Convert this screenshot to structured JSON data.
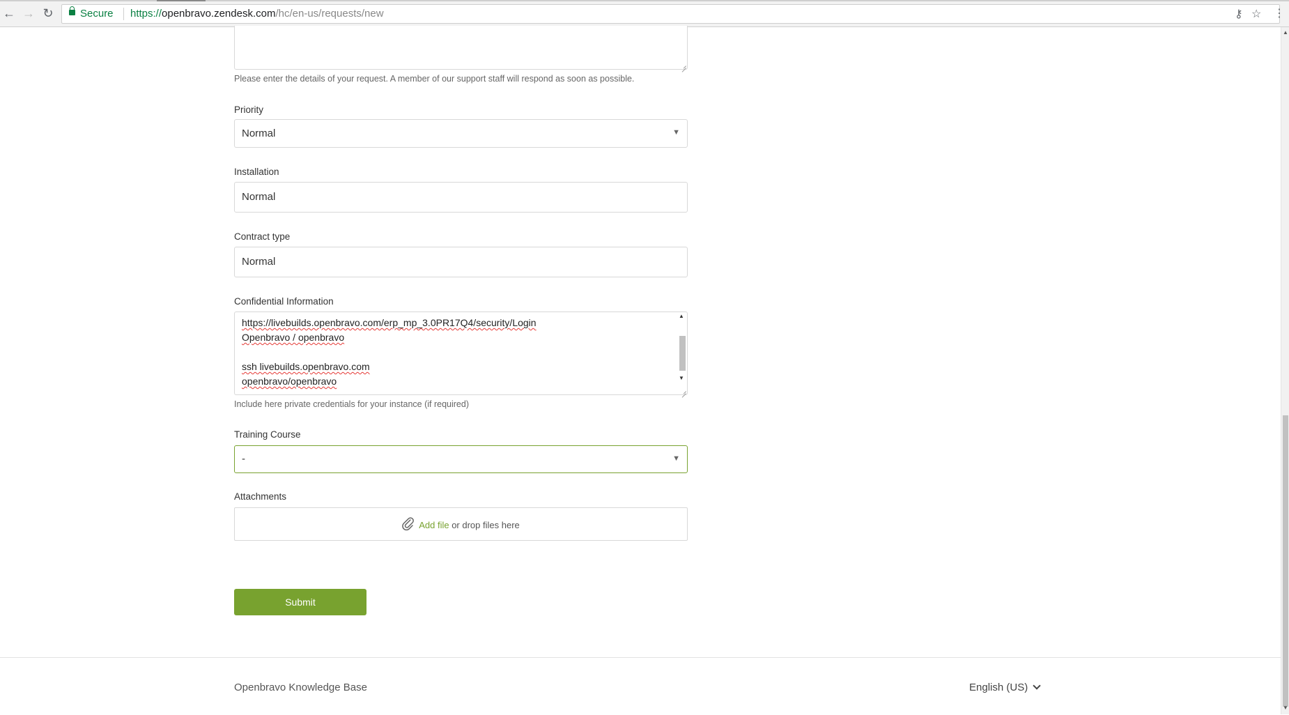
{
  "browser": {
    "secure_label": "Secure",
    "url_protocol": "https://",
    "url_host": "openbravo.zendesk.com",
    "url_path": "/hc/en-us/requests/new"
  },
  "form": {
    "description_hint": "Please enter the details of your request. A member of our support staff will respond as soon as possible.",
    "priority": {
      "label": "Priority",
      "value": "Normal"
    },
    "installation": {
      "label": "Installation",
      "value": "Normal"
    },
    "contract_type": {
      "label": "Contract type",
      "value": "Normal"
    },
    "confidential": {
      "label": "Confidential Information",
      "lines": [
        "https://livebuilds.openbravo.com/erp_mp_3.0PR17Q4/security/Login",
        "Openbravo / openbravo",
        "",
        "ssh livebuilds.openbravo.com",
        "openbravo/openbravo"
      ],
      "hint": "Include here private credentials for your instance (if required)"
    },
    "training_course": {
      "label": "Training Course",
      "value": "-"
    },
    "attachments": {
      "label": "Attachments",
      "add_file": "Add file",
      "drop_text": " or drop files here"
    },
    "submit_label": "Submit"
  },
  "footer": {
    "brand": "Openbravo Knowledge Base",
    "language": "English (US)"
  },
  "colors": {
    "accent": "#78a22f",
    "secure_green": "#0b8043"
  },
  "icons": [
    "back-icon",
    "forward-icon",
    "reload-icon",
    "lock-icon",
    "key-icon",
    "star-icon",
    "menu-icon",
    "paperclip-icon",
    "chevron-down-icon"
  ]
}
